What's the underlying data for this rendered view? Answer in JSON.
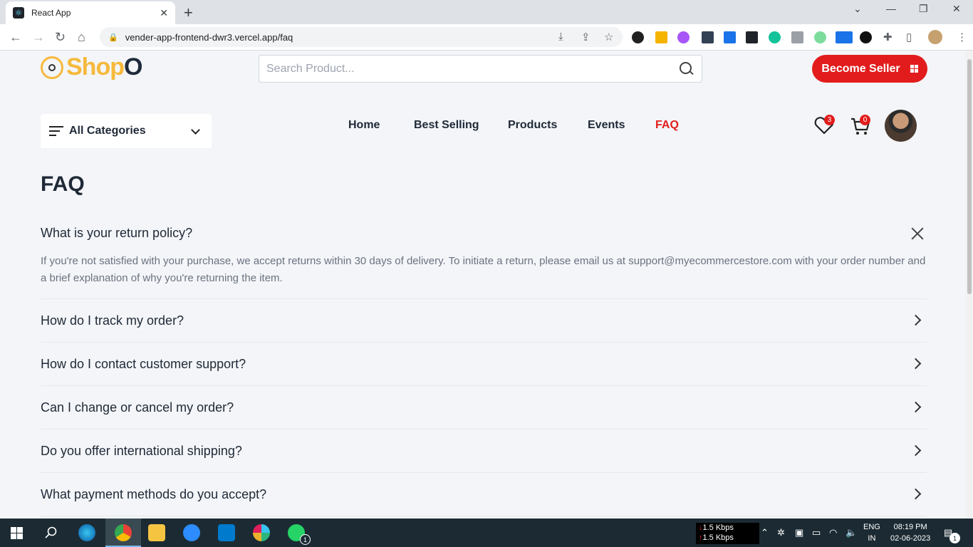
{
  "browser": {
    "tab_title": "React App",
    "url": "vender-app-frontend-dwr3.vercel.app/faq"
  },
  "header": {
    "logo_part1": "Shop",
    "logo_part2": "O",
    "search_placeholder": "Search Product...",
    "become_seller_label": "Become Seller",
    "categories_label": "All Categories",
    "nav": [
      "Home",
      "Best Selling",
      "Products",
      "Events",
      "FAQ"
    ],
    "active_nav": "FAQ",
    "wishlist_count": "3",
    "cart_count": "0"
  },
  "faq": {
    "title": "FAQ",
    "items": [
      {
        "question": "What is your return policy?",
        "answer": "If you're not satisfied with your purchase, we accept returns within 30 days of delivery. To initiate a return, please email us at support@myecommercestore.com with your order number and a brief explanation of why you're returning the item.",
        "expanded": true
      },
      {
        "question": "How do I track my order?",
        "expanded": false
      },
      {
        "question": "How do I contact customer support?",
        "expanded": false
      },
      {
        "question": "Can I change or cancel my order?",
        "expanded": false
      },
      {
        "question": "Do you offer international shipping?",
        "expanded": false
      },
      {
        "question": "What payment methods do you accept?",
        "expanded": false
      }
    ]
  },
  "taskbar": {
    "net_down": "1.5 Kbps",
    "net_up": "1.5 Kbps",
    "lang": "ENG",
    "region": "IN",
    "time": "08:19 PM",
    "date": "02-06-2023",
    "notifications": "1",
    "whatsapp_badge": "1"
  },
  "colors": {
    "accent_red": "#e21c1c",
    "logo_yellow": "#f6b93b",
    "page_bg": "#f3f5f8"
  }
}
